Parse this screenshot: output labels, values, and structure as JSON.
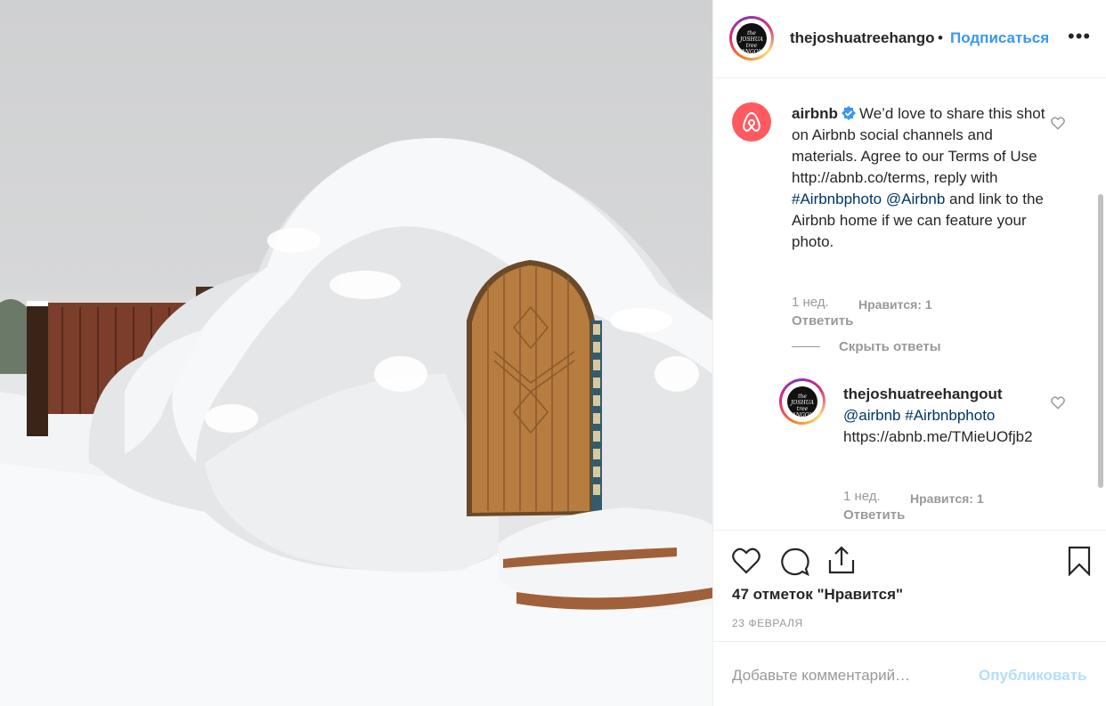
{
  "post": {
    "photo_alt_icon": "igloo-photo",
    "header": {
      "username": "thejoshuatreehangout",
      "separator": "•",
      "follow_label": "Подписаться",
      "more_label": "•••",
      "avatar_text": "the JOSHUA tree HANGOUT"
    },
    "comments": [
      {
        "username": "airbnb",
        "verified": true,
        "text_parts": [
          "We’d love to share this shot on Airbnb social channels and materials. Agree to our Terms of Use http://abnb.co/terms, reply with ",
          "#Airbnbphoto",
          " ",
          "@Airbnb",
          " and link to the Airbnb home if we can feature your photo."
        ],
        "time": "1 нед.",
        "likes": "Нравится: 1",
        "reply_label": "Ответить",
        "hide_replies_label": "Скрыть ответы"
      },
      {
        "username": "thejoshuatreehangout",
        "mention": "@airbnb",
        "hashtag": "#Airbnbphoto",
        "link": "https://abnb.me/TMieUOfjb2",
        "time": "1 нед.",
        "likes": "Нравится: 1",
        "reply_label": "Ответить"
      }
    ],
    "actions": {
      "like_icon": "heart-icon",
      "comment_icon": "comment-icon",
      "share_icon": "share-icon",
      "save_icon": "bookmark-icon"
    },
    "likes_count": "47 отметок \"Нравится\"",
    "date": "23 ФЕВРАЛЯ",
    "add_comment": {
      "placeholder": "Добавьте комментарий…",
      "publish_label": "Опубликовать"
    },
    "colors": {
      "accent": "#3897f0",
      "airbnb": "#ff5a5f",
      "link": "#003569",
      "muted": "#999999"
    }
  }
}
